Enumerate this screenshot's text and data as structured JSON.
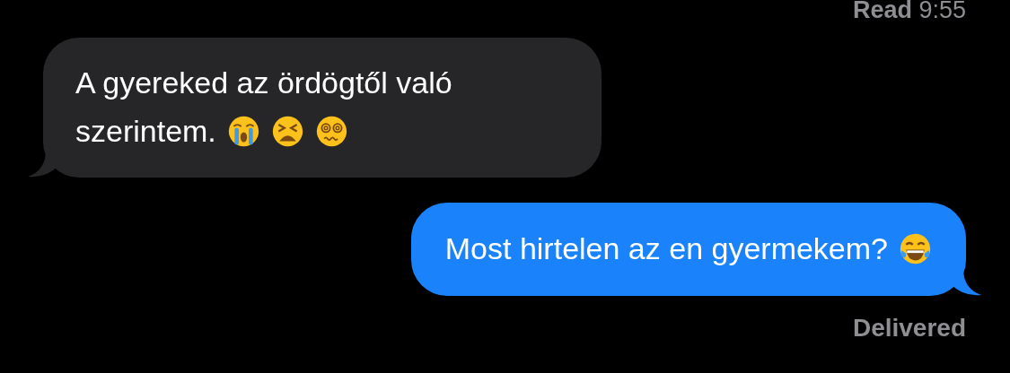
{
  "read_receipt": "**Read** 9:55",
  "messages": [
    {
      "kind": "received",
      "lines": [
        "A gyereked az ördögtől való",
        "szerintem."
      ],
      "emoji": [
        {
          "kind": "crying"
        },
        {
          "kind": "tired"
        },
        {
          "kind": "dizzy"
        }
      ]
    },
    {
      "kind": "sent",
      "lines": [
        "Most hirtelen az en gyermekem?"
      ],
      "emoji": [
        {
          "kind": "laughing"
        }
      ]
    }
  ],
  "status": "Delivered"
}
